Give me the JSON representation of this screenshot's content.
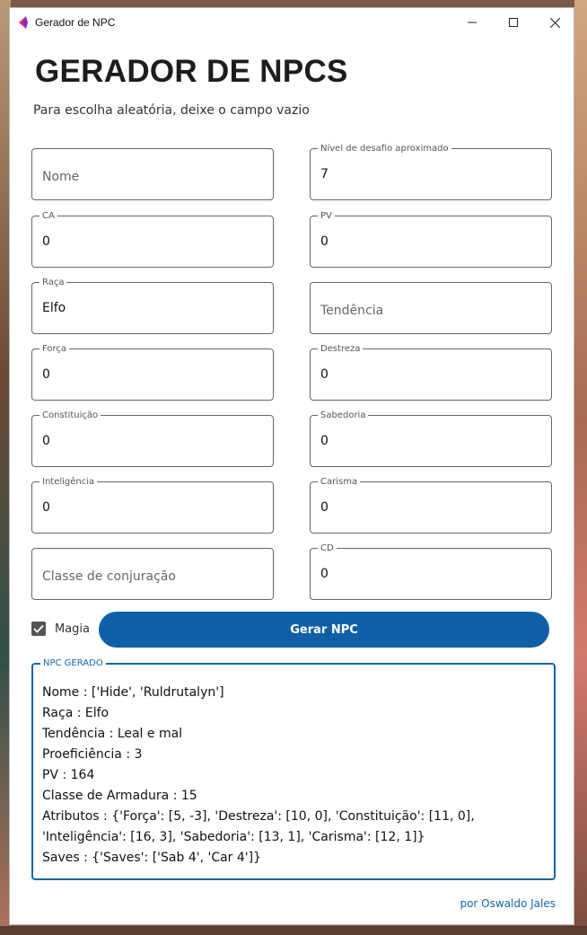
{
  "window": {
    "title": "Gerador de NPC"
  },
  "header": {
    "title": "GERADOR DE NPCS",
    "subtitle": "Para escolha aleatória, deixe o campo vazio"
  },
  "fields": {
    "nome": {
      "label": "",
      "placeholder": "Nome",
      "value": ""
    },
    "nivel_desafio": {
      "label": "Nível de desafio aproximado",
      "value": "7"
    },
    "ca": {
      "label": "CA",
      "value": "0"
    },
    "pv": {
      "label": "PV",
      "value": "0"
    },
    "raca": {
      "label": "Raça",
      "value": "Elfo"
    },
    "tendencia": {
      "label": "",
      "placeholder": "Tendência",
      "value": ""
    },
    "forca": {
      "label": "Força",
      "value": "0"
    },
    "destreza": {
      "label": "Destreza",
      "value": "0"
    },
    "constituicao": {
      "label": "Constituição",
      "value": "0"
    },
    "sabedoria": {
      "label": "Sabedoria",
      "value": "0"
    },
    "inteligencia": {
      "label": "Inteligência",
      "value": "0"
    },
    "carisma": {
      "label": "Carisma",
      "value": "0"
    },
    "classe_conjuracao": {
      "label": "",
      "placeholder": "Classe de conjuração",
      "value": ""
    },
    "cd": {
      "label": "CD",
      "value": "0"
    }
  },
  "magia": {
    "label": "Magia",
    "checked": true
  },
  "actions": {
    "generate_label": "Gerar NPC"
  },
  "output": {
    "label": "NPC GERADO",
    "lines": [
      "Nome : ['Hide', 'Ruldrutalyn']",
      "Raça : Elfo",
      "Tendência : Leal e mal",
      "Proeficiência : 3",
      "PV : 164",
      "Classe de Armadura : 15",
      "Atributos : {'Força': [5, -3], 'Destreza': [10, 0], 'Constituição': [11, 0],",
      "'Inteligência': [16, 3], 'Sabedoria': [13, 1], 'Carisma': [12, 1]}",
      "Saves : {'Saves': ['Sab 4', 'Car 4']}"
    ]
  },
  "footer": {
    "credit": "por Oswaldo Jales"
  },
  "colors": {
    "accent": "#0f5fa6",
    "outline": "#666666"
  }
}
